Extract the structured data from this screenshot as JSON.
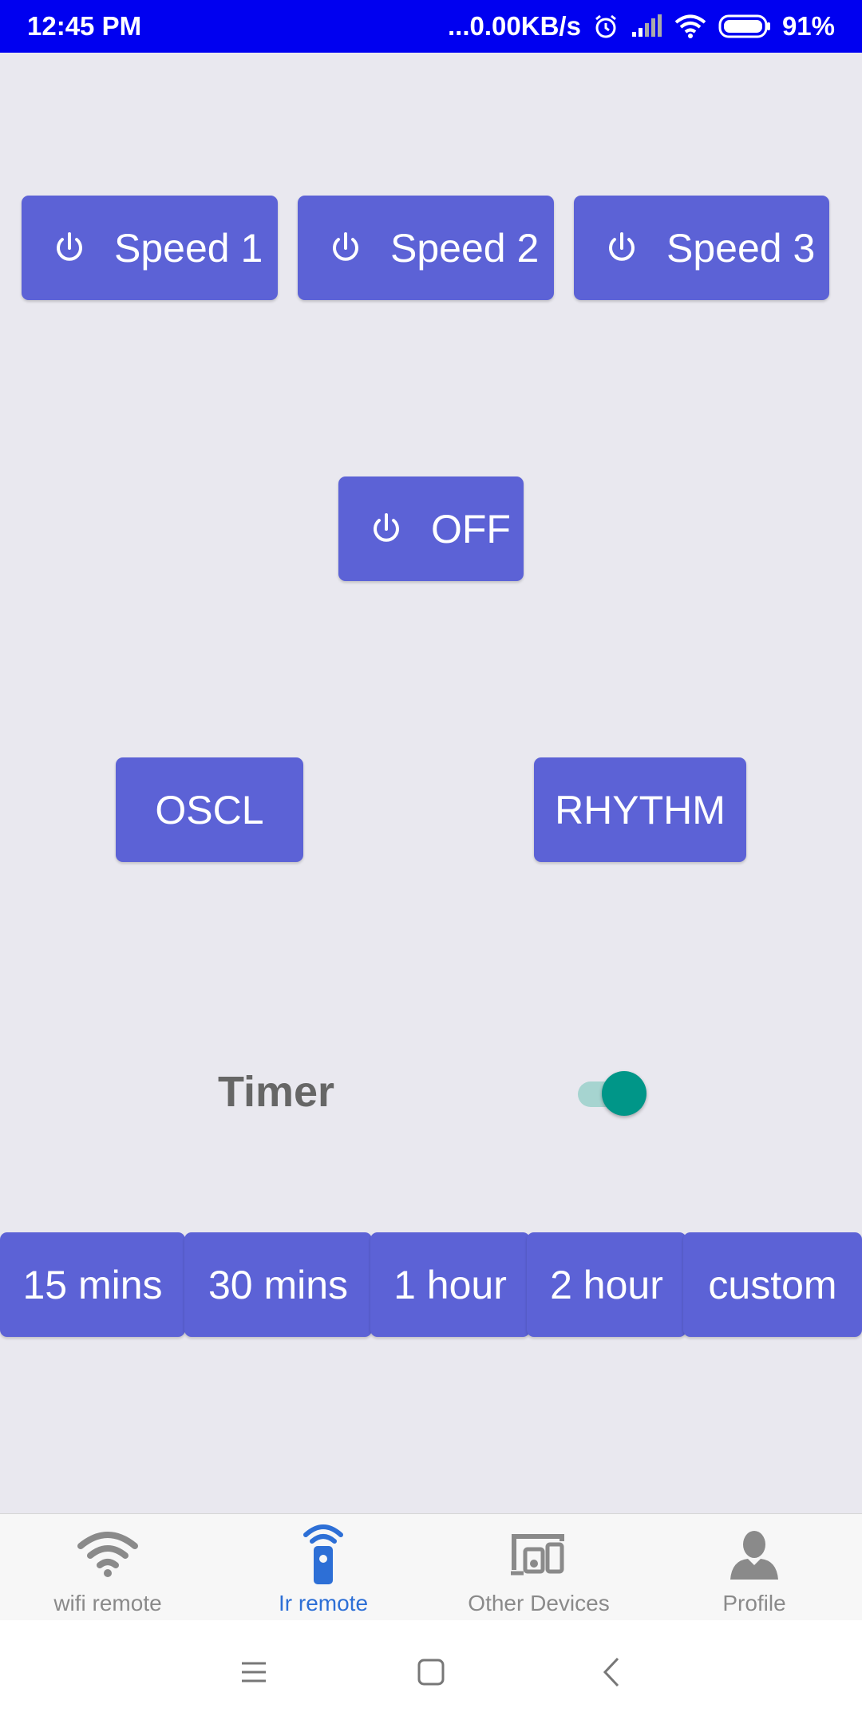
{
  "status_bar": {
    "time": "12:45 PM",
    "network_speed": "...0.00KB/s",
    "battery_percent": "91%",
    "icons": [
      "alarm-icon",
      "signal-icon",
      "wifi-icon",
      "battery-icon"
    ]
  },
  "speed_buttons": [
    {
      "label": "Speed 1",
      "icon": "power-icon"
    },
    {
      "label": "Speed 2",
      "icon": "power-icon"
    },
    {
      "label": "Speed 3",
      "icon": "power-icon"
    }
  ],
  "off_button": {
    "label": "OFF",
    "icon": "power-icon"
  },
  "mode_buttons": {
    "oscl": "OSCL",
    "rhythm": "RHYTHM"
  },
  "timer": {
    "label": "Timer",
    "enabled": true,
    "options": [
      "15 mins",
      "30 mins",
      "1 hour",
      "2 hour",
      "custom"
    ]
  },
  "bottom_nav": [
    {
      "label": "wifi remote",
      "icon": "wifi-icon",
      "active": false
    },
    {
      "label": "Ir remote",
      "icon": "ir-remote-icon",
      "active": true
    },
    {
      "label": "Other Devices",
      "icon": "devices-icon",
      "active": false
    },
    {
      "label": "Profile",
      "icon": "profile-icon",
      "active": false
    }
  ],
  "colors": {
    "button": "#5c62d6",
    "background": "#e9e8ef",
    "status_bar": "#0000f0",
    "toggle_on": "#009688",
    "active_nav": "#2d6fd6"
  }
}
